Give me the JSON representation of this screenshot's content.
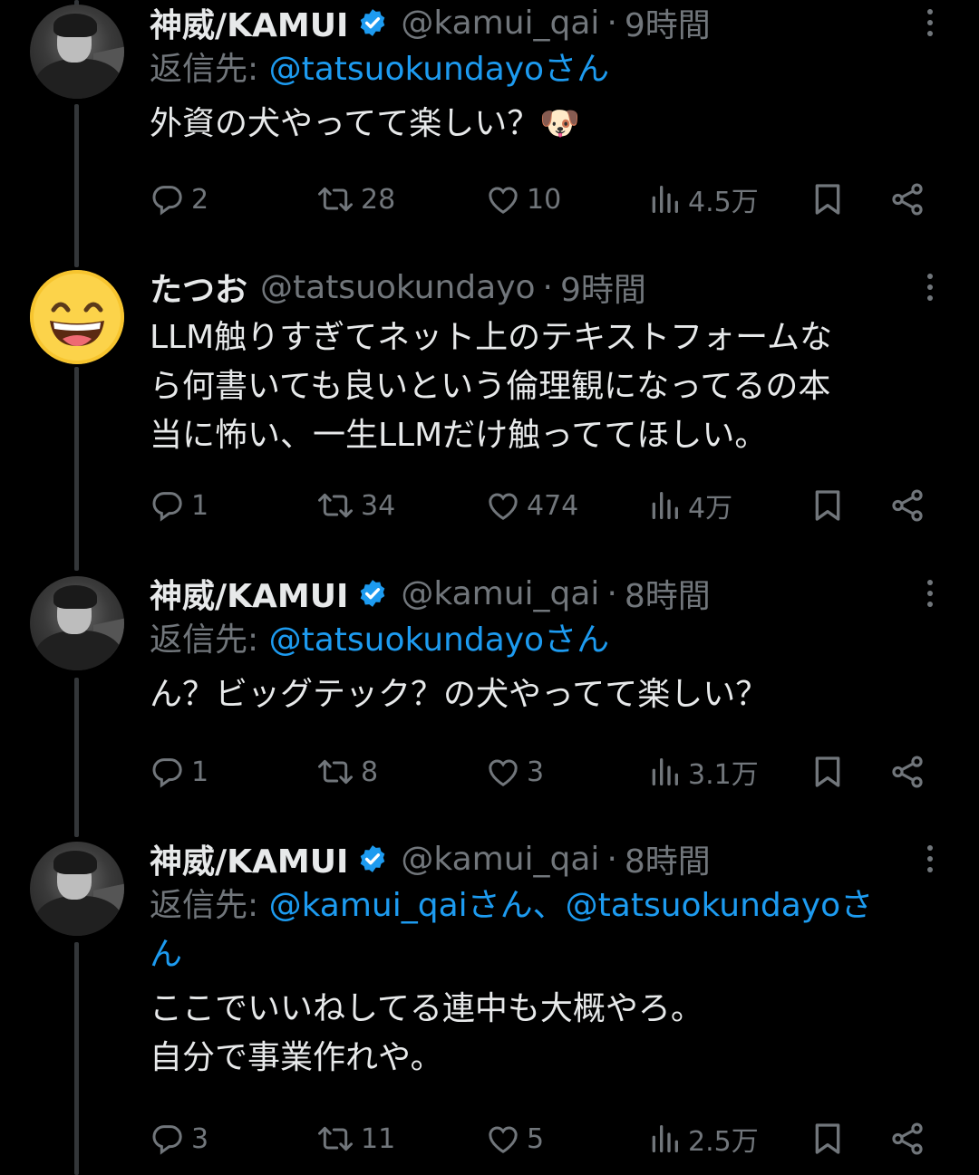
{
  "tweets": [
    {
      "display_name": "神威/KAMUI",
      "handle": "@kamui_qai",
      "dot": "·",
      "time": "9時間",
      "reply_prefix": "返信先: ",
      "reply_to": "@tatsuokundayoさん",
      "text": "外資の犬やってて楽しい？🐶",
      "replies": "2",
      "retweets": "28",
      "likes": "10",
      "views": "4.5万"
    },
    {
      "display_name": "たつお",
      "handle": "@tatsuokundayo",
      "dot": "·",
      "time": "9時間",
      "text": "LLM触りすぎてネット上のテキストフォームな\nら何書いても良いという倫理観になってるの本\n当に怖い、一生LLMだけ触っててほしい。",
      "replies": "1",
      "retweets": "34",
      "likes": "474",
      "views": "4万"
    },
    {
      "display_name": "神威/KAMUI",
      "handle": "@kamui_qai",
      "dot": "·",
      "time": "8時間",
      "reply_prefix": "返信先: ",
      "reply_to": "@tatsuokundayoさん",
      "text": "ん？ビッグテック？の犬やってて楽しい？",
      "replies": "1",
      "retweets": "8",
      "likes": "3",
      "views": "3.1万"
    },
    {
      "display_name": "神威/KAMUI",
      "handle": "@kamui_qai",
      "dot": "·",
      "time": "8時間",
      "reply_prefix": "返信先: ",
      "reply_to_1": "@kamui_qaiさん",
      "reply_sep": "、",
      "reply_to_2a": "@tatsuokundayoさ",
      "reply_to_2b": "ん",
      "text": "ここでいいねしてる連中も大概やろ。\n自分で事業作れや。",
      "replies": "3",
      "retweets": "11",
      "likes": "5",
      "views": "2.5万"
    }
  ],
  "colors": {
    "background": "#000000",
    "text": "#e7e9ea",
    "secondary": "#71767b",
    "accent": "#1d9bf0",
    "thread_line": "#333639"
  },
  "icons": [
    "reply-icon",
    "retweet-icon",
    "like-icon",
    "views-icon",
    "bookmark-icon",
    "share-icon",
    "verified-badge-icon",
    "more-icon"
  ]
}
